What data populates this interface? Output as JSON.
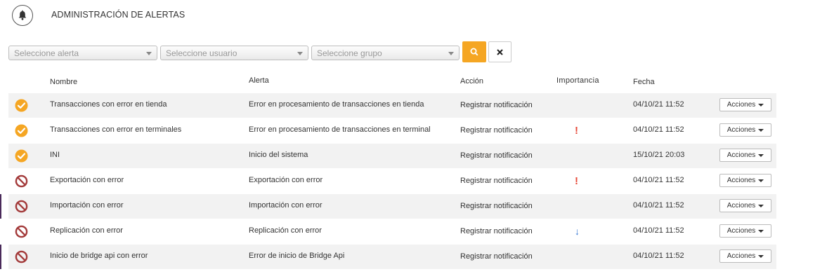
{
  "header": {
    "title": "ADMINISTRACIÓN DE ALERTAS",
    "icon": "bell-icon"
  },
  "filters": {
    "alert_placeholder": "Seleccione alerta",
    "user_placeholder": "Seleccione usuario",
    "group_placeholder": "Seleccione grupo",
    "search_icon": "search-icon",
    "clear_icon": "close-icon",
    "accent_color": "#f5a623"
  },
  "columns": {
    "nombre": "Nombre",
    "alerta": "Alerta",
    "accion": "Acción",
    "importancia": "Importancia",
    "fecha": "Fecha"
  },
  "rows": [
    {
      "status": "check",
      "nombre": "Transacciones con error en tienda",
      "alerta": "Error en procesamiento de transacciones en tienda",
      "accion": "Registrar notificación",
      "importancia": "",
      "fecha": "04/10/21 11:52",
      "acciones": "Acciones"
    },
    {
      "status": "check",
      "nombre": "Transacciones con error en terminales",
      "alerta": "Error en procesamiento de transacciones en terminal",
      "accion": "Registrar notificación",
      "importancia": "!",
      "fecha": "04/10/21 11:52",
      "acciones": "Acciones"
    },
    {
      "status": "check",
      "nombre": "INI",
      "alerta": "Inicio del sistema",
      "accion": "Registrar notificación",
      "importancia": "",
      "fecha": "15/10/21 20:03",
      "acciones": "Acciones"
    },
    {
      "status": "blocked",
      "nombre": "Exportación con error",
      "alerta": "Exportación con error",
      "accion": "Registrar notificación",
      "importancia": "!",
      "fecha": "04/10/21 11:52",
      "acciones": "Acciones"
    },
    {
      "status": "blocked",
      "nombre": "Importación con error",
      "alerta": "Importación con error",
      "accion": "Registrar notificación",
      "importancia": "",
      "fecha": "04/10/21 11:52",
      "acciones": "Acciones"
    },
    {
      "status": "blocked",
      "nombre": "Replicación con error",
      "alerta": "Replicación con error",
      "accion": "Registrar notificación",
      "importancia": "↓",
      "fecha": "04/10/21 11:52",
      "acciones": "Acciones"
    },
    {
      "status": "blocked",
      "nombre": "Inicio de bridge api con error",
      "alerta": "Error de inicio de Bridge Api",
      "accion": "Registrar notificación",
      "importancia": "",
      "fecha": "04/10/21 11:52",
      "acciones": "Acciones"
    }
  ],
  "colors": {
    "check": "#f5a623",
    "blocked": "#a33a3a",
    "importance_high": "#e74c3c",
    "importance_low": "#3a7bd5"
  }
}
